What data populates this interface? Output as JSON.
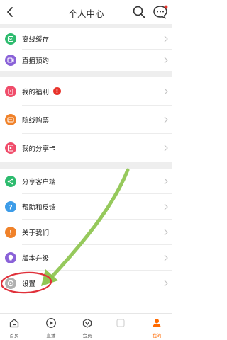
{
  "header": {
    "title": "个人中心"
  },
  "colors": {
    "accent": "#ff6a00",
    "annotation_green": "#8bc34a",
    "annotation_red": "#e0303a"
  },
  "menu": [
    {
      "label": "离线缓存",
      "icon": "download-icon",
      "color": "#2dbb6e"
    },
    {
      "label": "直播预约",
      "icon": "live-reserve-icon",
      "color": "#8a62d8"
    },
    {
      "label": "我的福利",
      "icon": "gift-icon",
      "color": "#f04c6a",
      "badge": "!"
    },
    {
      "label": "院线购票",
      "icon": "ticket-icon",
      "color": "#f0822a"
    },
    {
      "label": "我的分享卡",
      "icon": "share-card-icon",
      "color": "#f04c6a"
    },
    {
      "label": "分享客户端",
      "icon": "share-icon",
      "color": "#2dbb6e"
    },
    {
      "label": "帮助和反馈",
      "icon": "help-icon",
      "color": "#3d9ce8"
    },
    {
      "label": "关于我们",
      "icon": "info-icon",
      "color": "#f0822a"
    },
    {
      "label": "版本升级",
      "icon": "upgrade-icon",
      "color": "#8a62d8"
    },
    {
      "label": "设置",
      "icon": "settings-icon",
      "color": "#b0b0b0"
    }
  ],
  "tabs": [
    {
      "label": "首页",
      "icon": "home-icon"
    },
    {
      "label": "直播",
      "icon": "play-icon"
    },
    {
      "label": "会员",
      "icon": "vip-icon"
    },
    {
      "label": "",
      "icon": "partial-tab-icon"
    },
    {
      "label": "我的",
      "icon": "profile-icon",
      "active": true
    }
  ]
}
